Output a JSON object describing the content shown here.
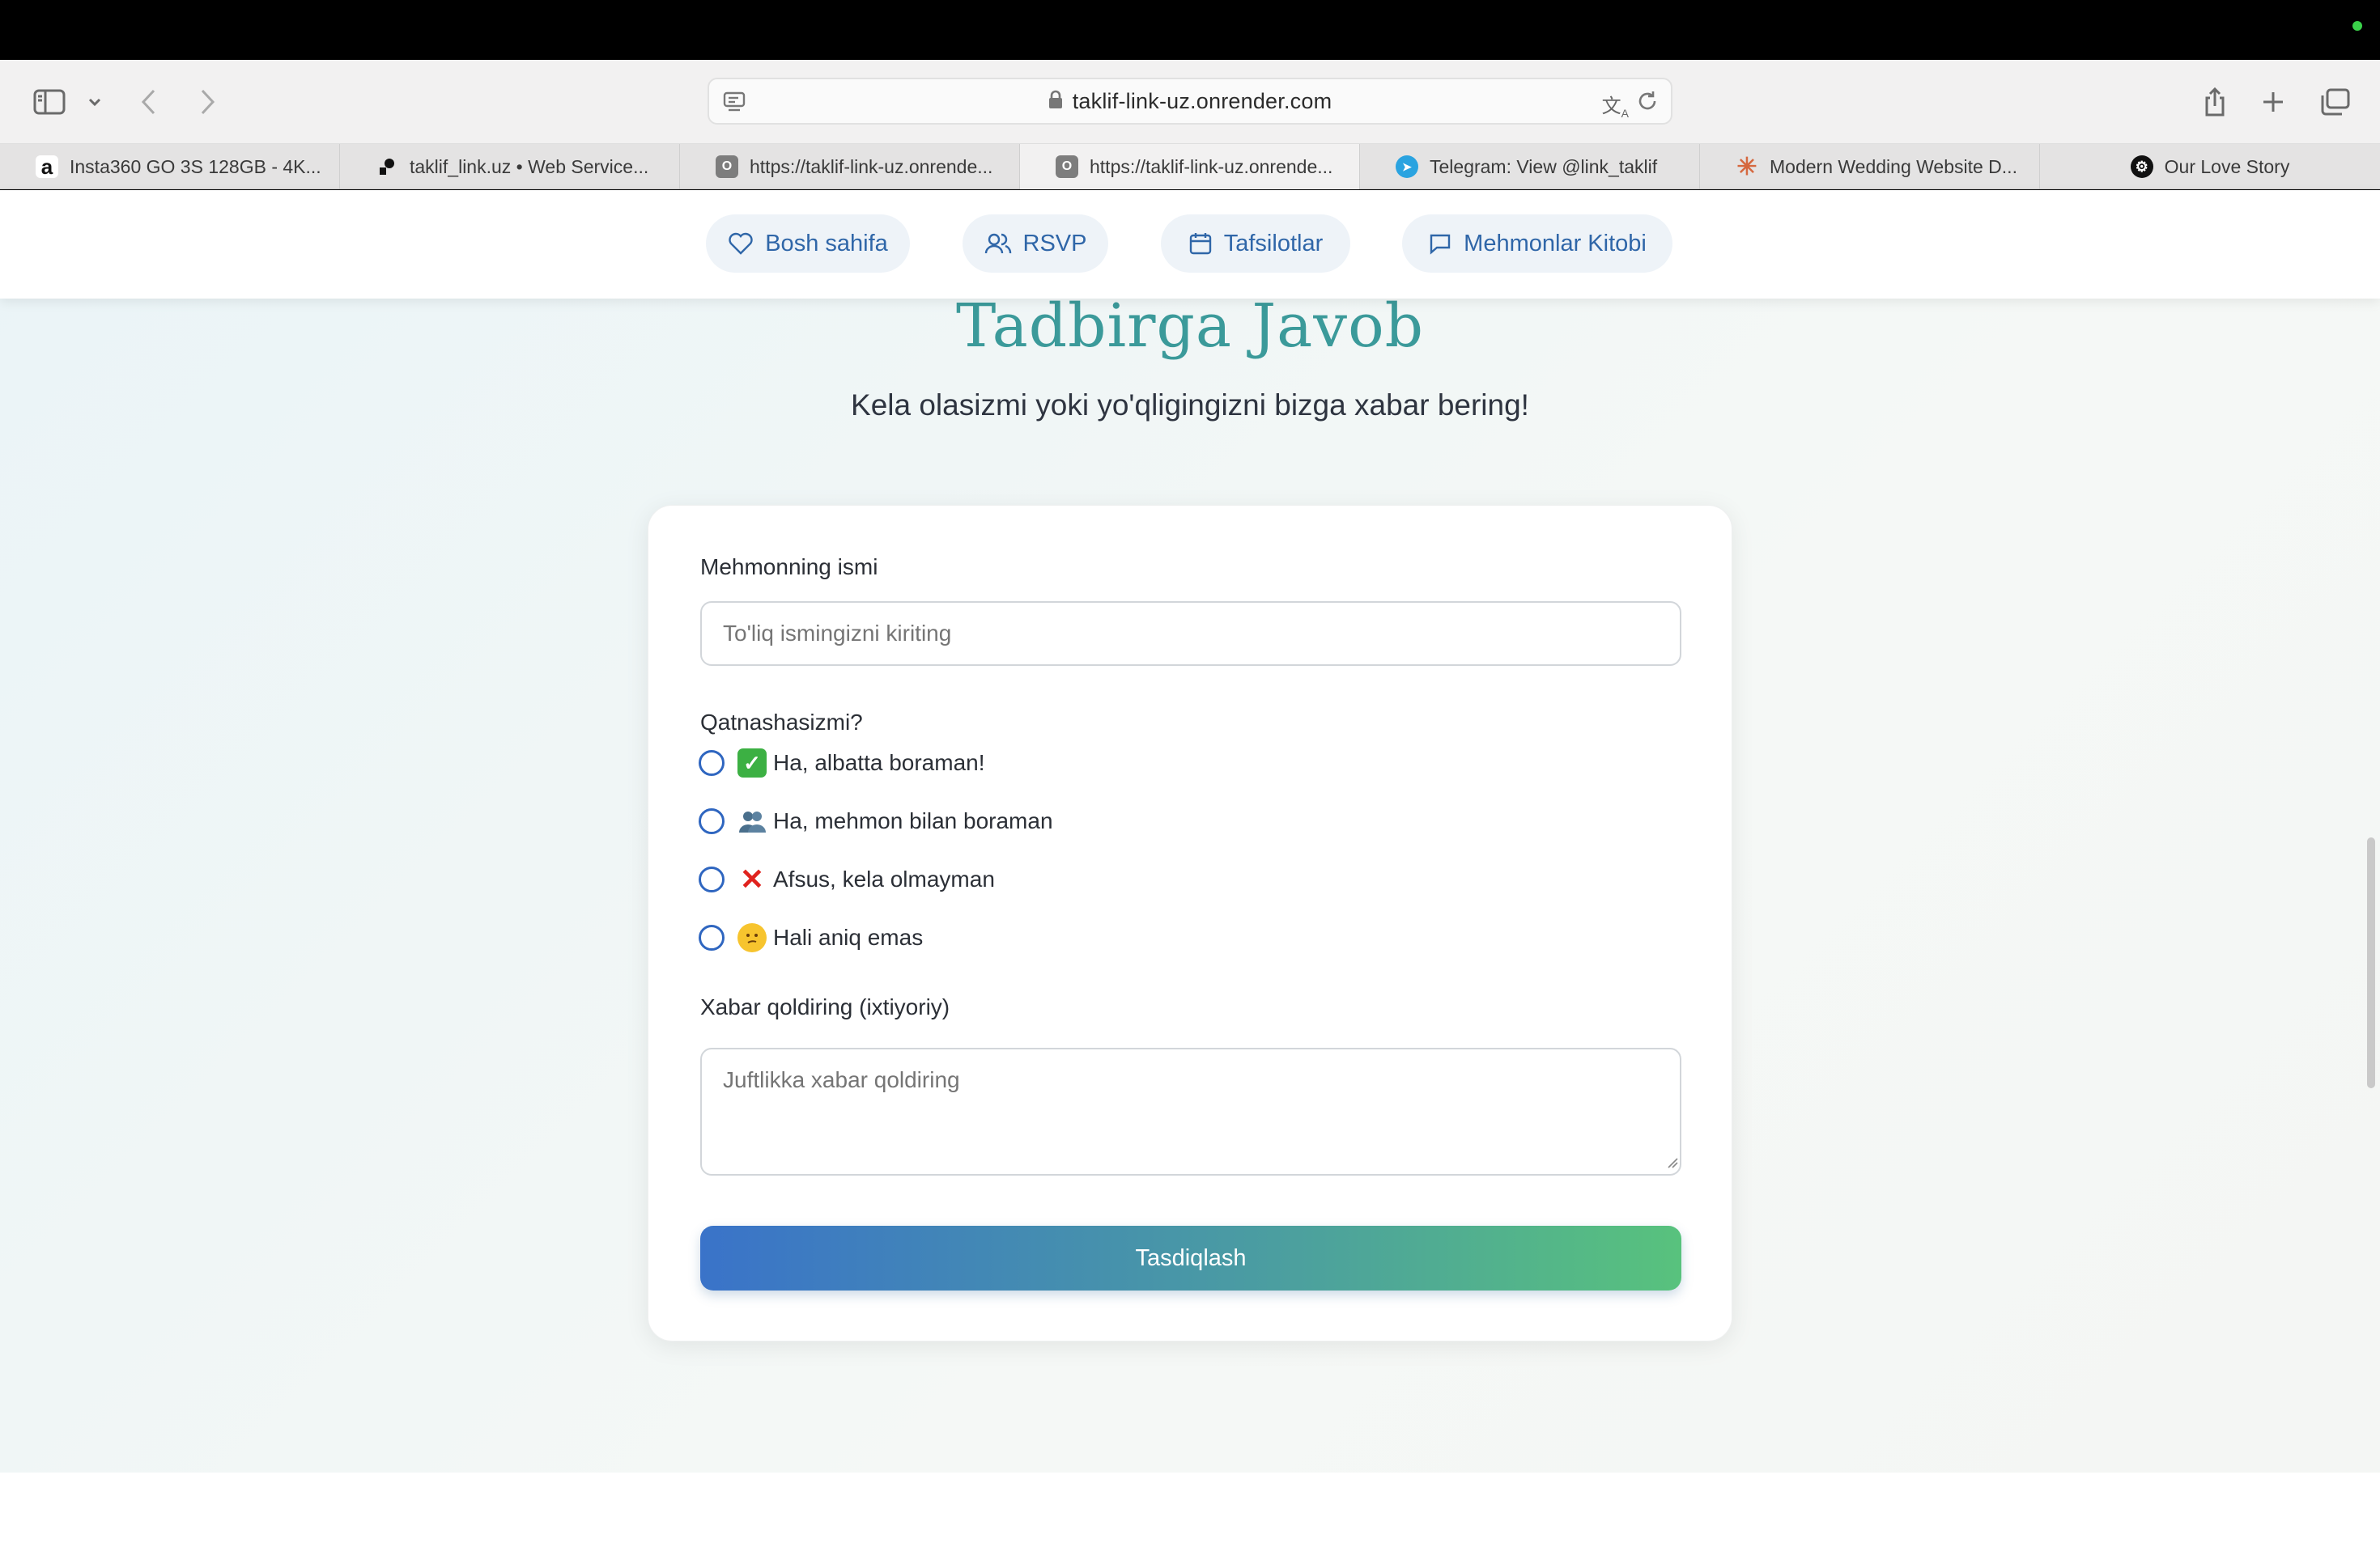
{
  "browser": {
    "url": "taklif-link-uz.onrender.com",
    "tabs": [
      {
        "title": "Insta360 GO 3S 128GB - 4K...",
        "favicon": "amazon-icon"
      },
      {
        "title": "taklif_link.uz • Web Service...",
        "favicon": "render-icon"
      },
      {
        "title": "https://taklif-link-uz.onrende...",
        "favicon": "site-icon"
      },
      {
        "title": "https://taklif-link-uz.onrende...",
        "favicon": "site-icon",
        "active": true
      },
      {
        "title": "Telegram: View @link_taklif",
        "favicon": "telegram-icon"
      },
      {
        "title": "Modern Wedding Website D...",
        "favicon": "claude-icon"
      },
      {
        "title": "Our Love Story",
        "favicon": "openai-icon"
      }
    ]
  },
  "nav": {
    "items": [
      {
        "label": "Bosh sahifa",
        "icon": "heart-icon"
      },
      {
        "label": "RSVP",
        "icon": "users-icon"
      },
      {
        "label": "Tafsilotlar",
        "icon": "calendar-icon"
      },
      {
        "label": "Mehmonlar Kitobi",
        "icon": "message-icon"
      }
    ]
  },
  "page": {
    "title": "Tadbirga Javob",
    "subtitle": "Kela olasizmi yoki yo'qligingizni bizga xabar bering!"
  },
  "form": {
    "name_label": "Mehmonning ismi",
    "name_placeholder": "To'liq ismingizni kiriting",
    "attend_label": "Qatnashasizmi?",
    "options": [
      {
        "emoji": "✅",
        "label": "Ha, albatta boraman!"
      },
      {
        "emoji": "👥",
        "label": "Ha, mehmon bilan boraman"
      },
      {
        "emoji": "❌",
        "label": "Afsus, kela olmayman"
      },
      {
        "emoji": "🤔",
        "label": "Hali aniq emas"
      }
    ],
    "message_label": "Xabar qoldiring (ixtiyoriy)",
    "message_placeholder": "Juftlikka xabar qoldiring",
    "submit_label": "Tasdiqlash"
  },
  "colors": {
    "accent": "#2f66a8",
    "title": "#3b9a9a",
    "button_gradient_start": "#3a73c9",
    "button_gradient_end": "#58c27d"
  }
}
